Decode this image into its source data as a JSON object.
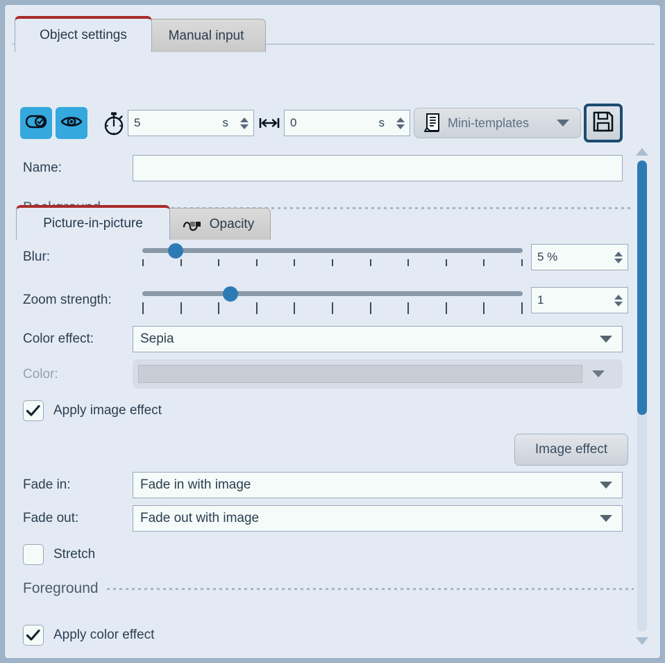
{
  "window": {
    "background_color": "#e3eaf4",
    "accent_color": "#2e7ab5",
    "tab_accent_color": "#a82c28"
  },
  "tabs": {
    "items": [
      {
        "label": "Object settings",
        "active": true
      },
      {
        "label": "Manual input",
        "active": false
      }
    ]
  },
  "toolbar": {
    "enable_button_icon": "toggle-check-icon",
    "visible_button_icon": "eye-icon",
    "duration": {
      "icon": "stopwatch-icon",
      "value": "5",
      "unit": "s"
    },
    "delay": {
      "icon": "horizontal-arrows-icon",
      "value": "0",
      "unit": "s"
    },
    "templates": {
      "icon": "document-list-icon",
      "label": "Mini-templates",
      "dropdown_icon": "chevron-down-icon"
    },
    "save": {
      "icon": "floppy-disk-icon",
      "label": "Save"
    }
  },
  "subtabs": {
    "items": [
      {
        "label": "Picture-in-picture",
        "active": true,
        "icon": null
      },
      {
        "label": "Opacity",
        "active": false,
        "icon": "opacity-curve-icon"
      }
    ]
  },
  "panel": {
    "name": {
      "label": "Name:",
      "value": "",
      "placeholder": ""
    },
    "sections": {
      "background": {
        "title": "Background"
      },
      "foreground": {
        "title": "Foreground"
      }
    },
    "blur": {
      "label": "Blur:",
      "value": "5 %",
      "slider_percent": 7,
      "tick_count": 11
    },
    "zoom_strength": {
      "label": "Zoom strength:",
      "value": "1",
      "slider_percent": 22,
      "tick_count": 11
    },
    "color_effect": {
      "label": "Color effect:",
      "value": "Sepia",
      "dropdown_icon": "chevron-down-icon"
    },
    "color": {
      "label": "Color:",
      "value": "",
      "disabled": true,
      "swatch_color": "#c9ced6",
      "dropdown_icon": "chevron-down-icon"
    },
    "apply_image_effect": {
      "label": "Apply image effect",
      "checked": true
    },
    "image_effect_button": {
      "label": "Image effect"
    },
    "fade_in": {
      "label": "Fade in:",
      "value": "Fade in with image",
      "dropdown_icon": "chevron-down-icon"
    },
    "fade_out": {
      "label": "Fade out:",
      "value": "Fade out with image",
      "dropdown_icon": "chevron-down-icon"
    },
    "stretch": {
      "label": "Stretch",
      "checked": false
    },
    "apply_color_effect": {
      "label": "Apply color effect",
      "checked": true
    }
  },
  "scrollbar": {
    "up_icon": "triangle-up-icon",
    "down_icon": "triangle-down-icon",
    "thumb_position_percent": 0,
    "thumb_size_percent": 54
  }
}
